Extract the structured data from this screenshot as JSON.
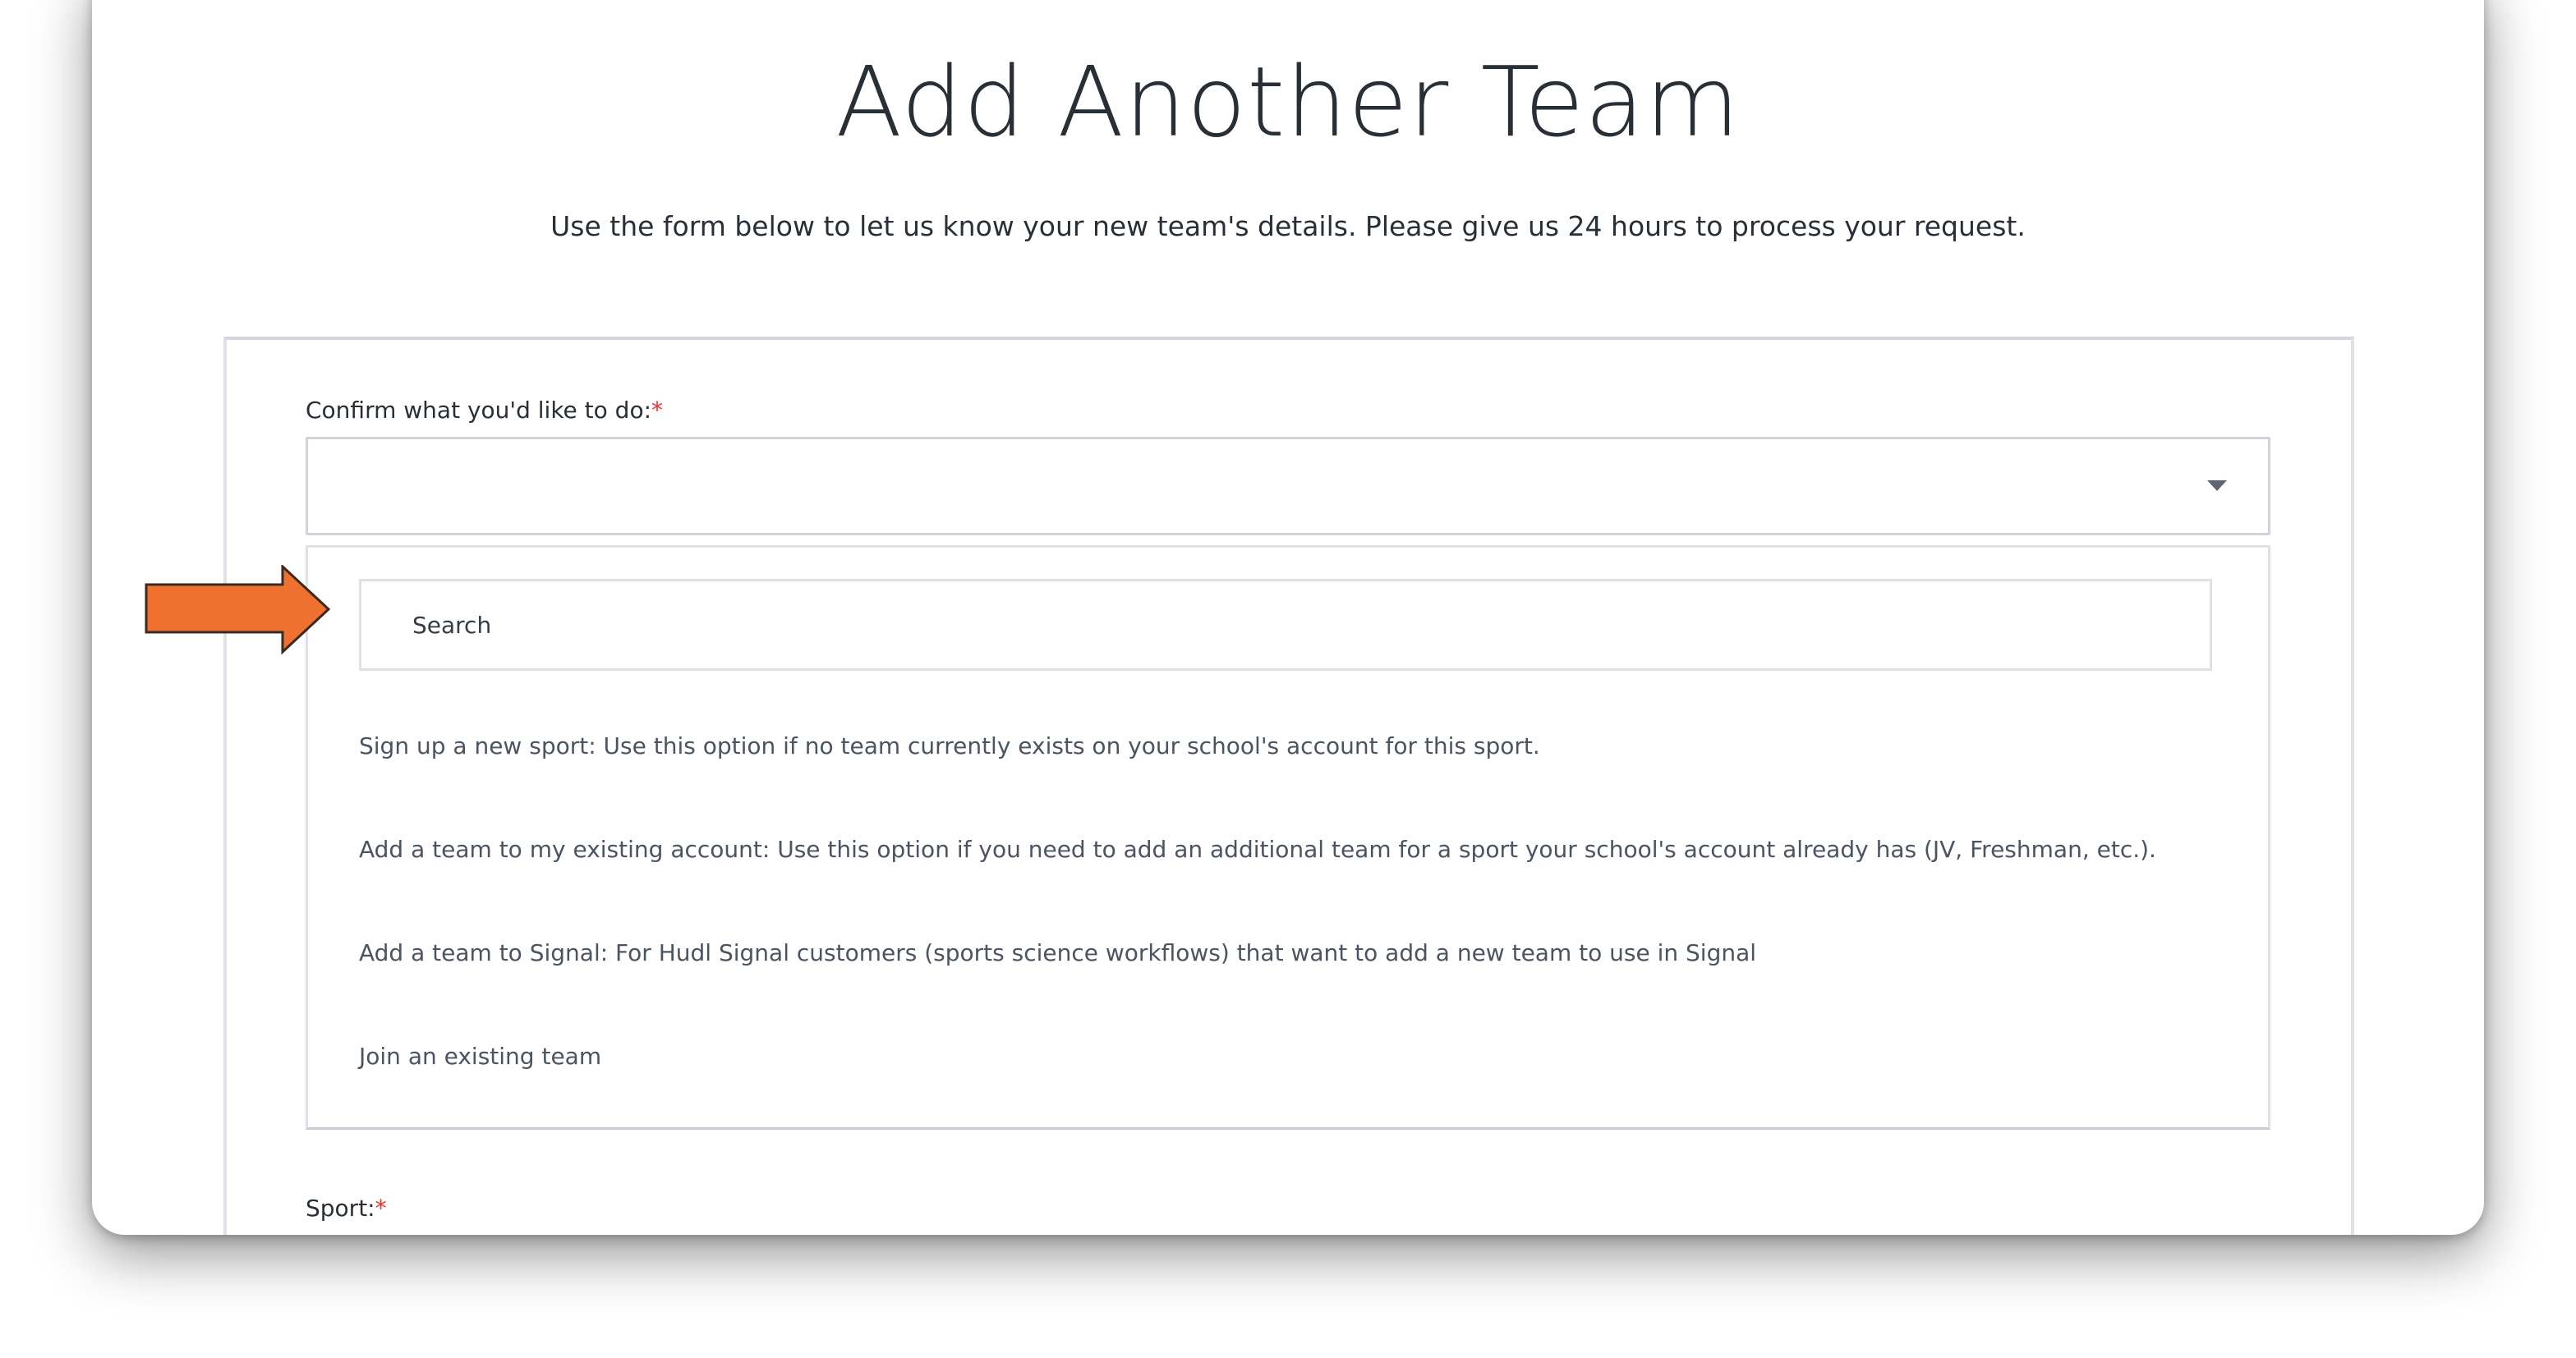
{
  "page": {
    "title": "Add Another Team",
    "subtitle": "Use the form below to let us know your new team's details. Please give us 24 hours to process your request."
  },
  "form": {
    "action_field": {
      "label": "Confirm what you'd like to do:",
      "required_mark": "*",
      "selected_value": "",
      "search_placeholder": "Search",
      "options": [
        "Sign up a new sport: Use this option if no team currently exists on your school's account for this sport.",
        "Add a team to my existing account: Use this option if you need to add an additional team for a sport your school's account already has (JV, Freshman, etc.).",
        "Add a team to Signal: For Hudl Signal customers (sports science workflows) that want to add a new team to use in Signal",
        "Join an existing team"
      ]
    },
    "next_field": {
      "label": "Sport:",
      "required_mark": "*"
    }
  },
  "annotation": {
    "icon": "arrow-right-icon",
    "color": "#ee7130"
  }
}
